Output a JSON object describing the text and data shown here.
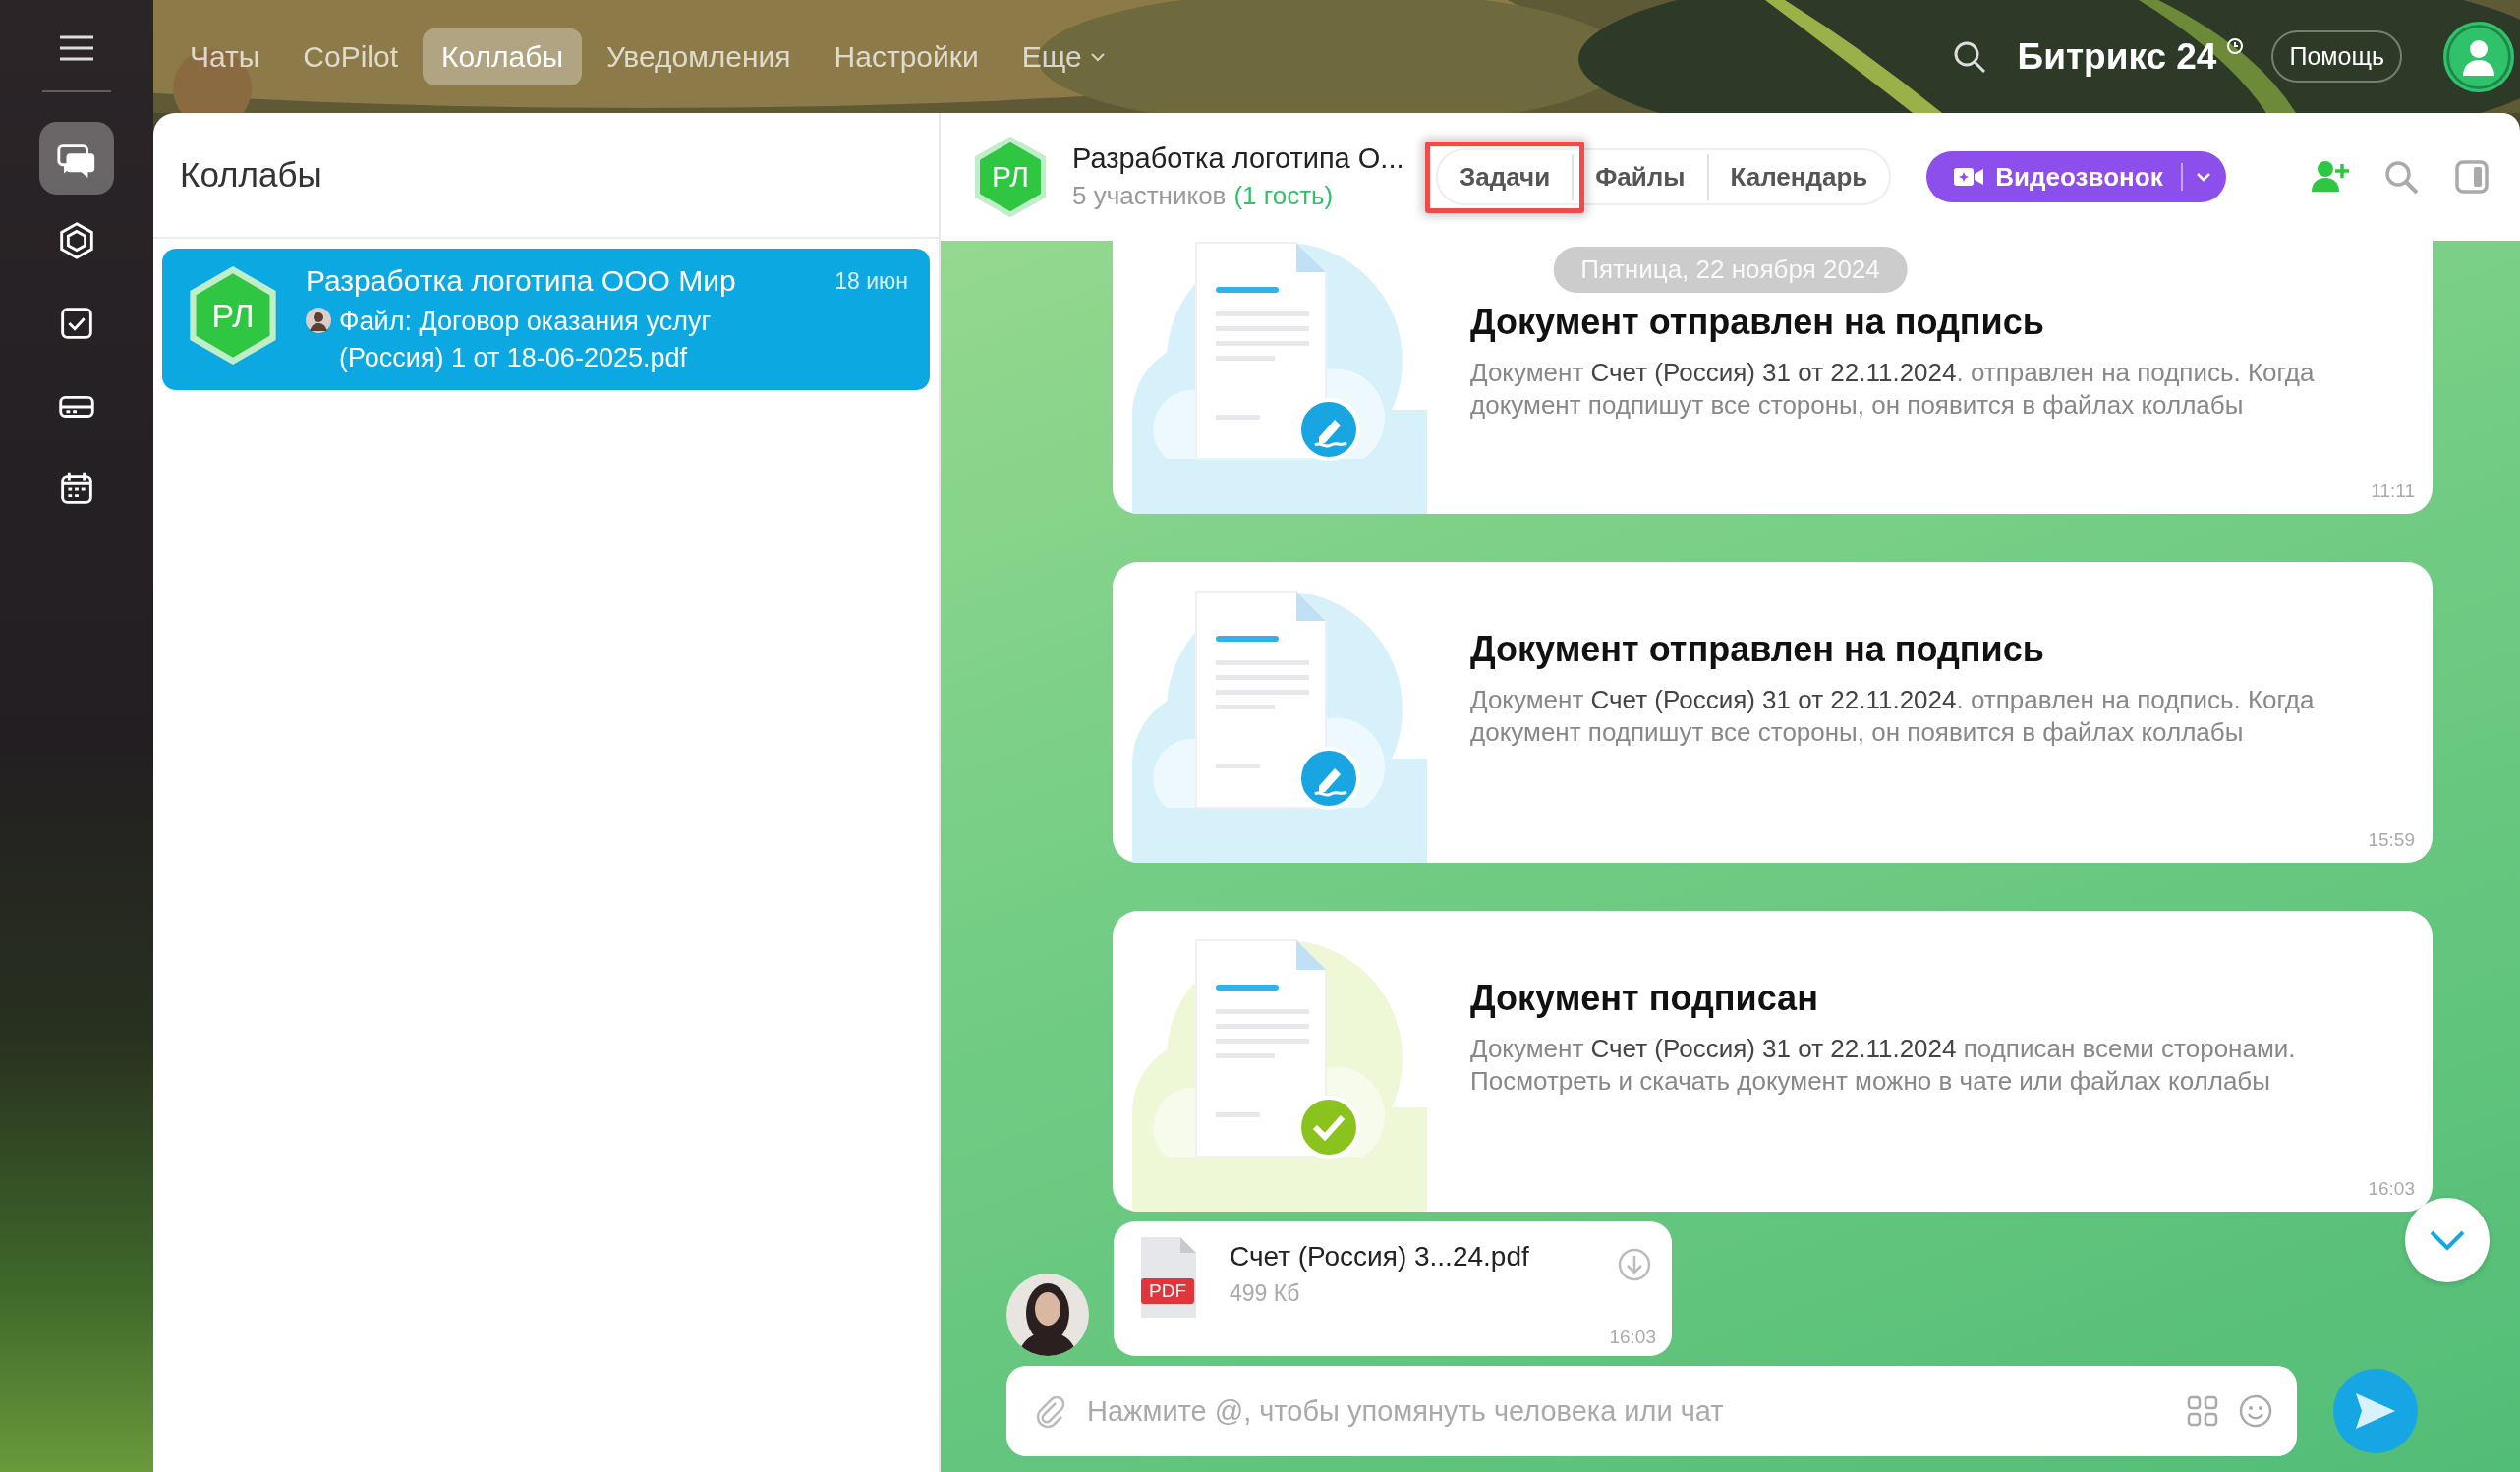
{
  "rail": {
    "items": [
      {
        "selected": true
      },
      {
        "selected": false
      },
      {
        "selected": false
      },
      {
        "selected": false
      },
      {
        "selected": false
      }
    ]
  },
  "top_tabs": [
    {
      "label": "Чаты",
      "selected": false,
      "kind": "plain"
    },
    {
      "label": "CoPilot",
      "selected": false,
      "kind": "plain"
    },
    {
      "label": "Коллабы",
      "selected": true,
      "kind": "plain"
    },
    {
      "label": "Уведомления",
      "selected": false,
      "kind": "plain"
    },
    {
      "label": "Настройки",
      "selected": false,
      "kind": "plain"
    },
    {
      "label": "Еще",
      "selected": false,
      "kind": "dropdown"
    }
  ],
  "brand": "Битрикс 24",
  "help_button": "Помощь",
  "sidebar": {
    "title": "Коллабы",
    "chats": [
      {
        "avatar": "РЛ",
        "name": "Разработка логотипа ООО Мир",
        "date": "18 июн",
        "preview": "Файл: Договор оказания услуг (Россия) 1 от 18-06-2025.pdf",
        "selected": true
      }
    ]
  },
  "chat_header": {
    "avatar": "РЛ",
    "title": "Разработка логотипа О...",
    "members": "5 участников",
    "guests": "(1 гость)",
    "tabs": [
      {
        "label": "Задачи",
        "highlighted": true
      },
      {
        "label": "Файлы",
        "highlighted": false
      },
      {
        "label": "Календарь",
        "highlighted": false
      }
    ],
    "call_button": "Видеозвонок"
  },
  "date_pill": "Пятница, 22 ноября 2024",
  "messages": [
    {
      "kind": "pending",
      "title": "Документ отправлен на подпись",
      "body": "Документ **Счет (Россия) 31 от 22.11.2024**. отправлен на подпись. Когда документ подпишут все стороны, он появится в файлах коллабы",
      "time": "11:11"
    },
    {
      "kind": "pending",
      "title": "Документ отправлен на подпись",
      "body": "Документ **Счет (Россия) 31 от 22.11.2024**. отправлен на подпись. Когда документ подпишут все стороны, он появится в файлах коллабы",
      "time": "15:59"
    },
    {
      "kind": "signed",
      "title": "Документ подписан",
      "body": "Документ **Счет (Россия) 31 от 22.11.2024** подписан всеми сторонами. Посмотреть и скачать документ можно в чате или файлах коллабы",
      "time": "16:03"
    }
  ],
  "file_message": {
    "name": "Счет (Россия) 3...24.pdf",
    "file_type": "PDF",
    "size": "499 Кб",
    "time": "16:03"
  },
  "composer": {
    "placeholder": "Нажмите @, чтобы упомянуть человека или чат"
  }
}
